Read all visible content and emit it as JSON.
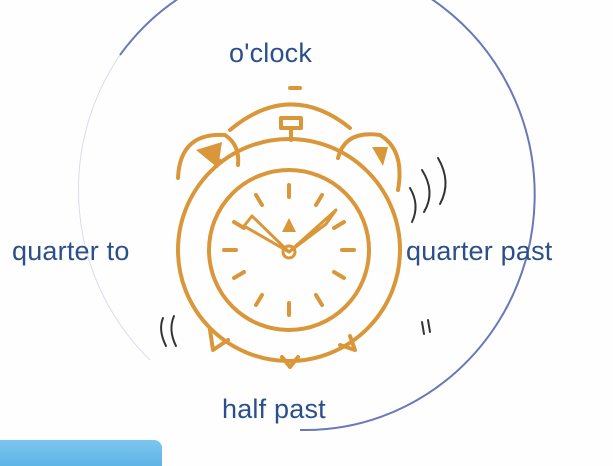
{
  "labels": {
    "top": "o'clock",
    "left": "quarter to",
    "right": "quarter past",
    "bottom": "half past"
  },
  "colors": {
    "clock": "#d9973a",
    "arc": "#6b78b8",
    "text": "#2a4f8a",
    "badge": "#5ab3e6"
  },
  "icons": {
    "clock": "alarm-clock-icon"
  }
}
